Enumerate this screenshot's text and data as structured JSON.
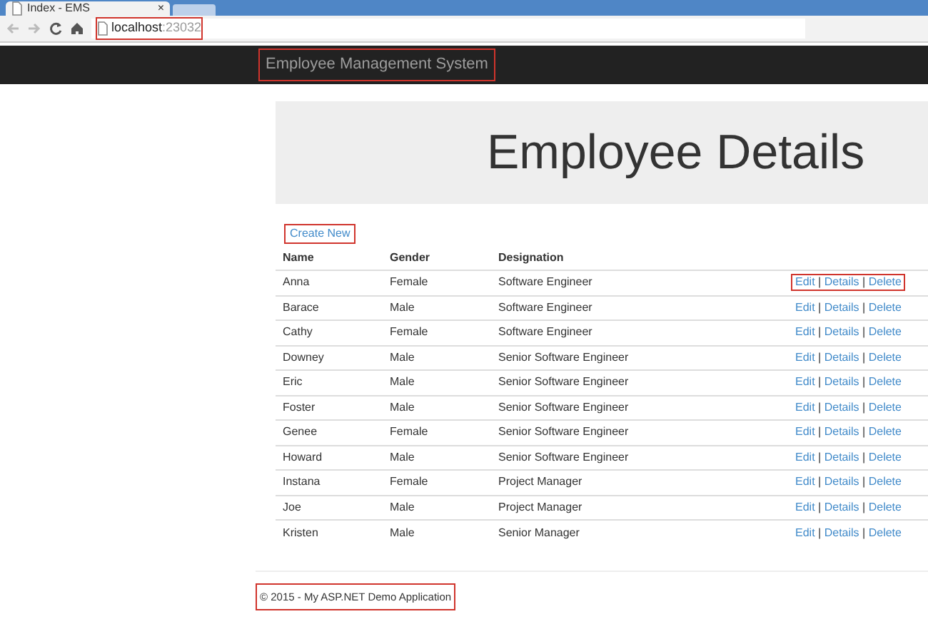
{
  "browser": {
    "tab": {
      "title": "Index - EMS",
      "close": "×"
    },
    "address": {
      "host": "localhost",
      "port": ":23032",
      "highlighted": true
    }
  },
  "navbar": {
    "brand": "Employee Management System",
    "highlighted": true
  },
  "jumbotron": {
    "title": "Employee Details"
  },
  "create_link": {
    "label": "Create New",
    "highlighted": true
  },
  "table": {
    "columns": [
      "Name",
      "Gender",
      "Designation"
    ],
    "action_separator": "|",
    "rows": [
      {
        "name": "Anna",
        "gender": "Female",
        "designation": "Software Engineer",
        "actions": [
          "Edit",
          "Details",
          "Delete"
        ],
        "highlighted": true
      },
      {
        "name": "Barace",
        "gender": "Male",
        "designation": "Software Engineer",
        "actions": [
          "Edit",
          "Details",
          "Delete"
        ],
        "highlighted": false
      },
      {
        "name": "Cathy",
        "gender": "Female",
        "designation": "Software Engineer",
        "actions": [
          "Edit",
          "Details",
          "Delete"
        ],
        "highlighted": false
      },
      {
        "name": "Downey",
        "gender": "Male",
        "designation": "Senior Software Engineer",
        "actions": [
          "Edit",
          "Details",
          "Delete"
        ],
        "highlighted": false
      },
      {
        "name": "Eric",
        "gender": "Male",
        "designation": "Senior Software Engineer",
        "actions": [
          "Edit",
          "Details",
          "Delete"
        ],
        "highlighted": false
      },
      {
        "name": "Foster",
        "gender": "Male",
        "designation": "Senior Software Engineer",
        "actions": [
          "Edit",
          "Details",
          "Delete"
        ],
        "highlighted": false
      },
      {
        "name": "Genee",
        "gender": "Female",
        "designation": "Senior Software Engineer",
        "actions": [
          "Edit",
          "Details",
          "Delete"
        ],
        "highlighted": false
      },
      {
        "name": "Howard",
        "gender": "Male",
        "designation": "Senior Software Engineer",
        "actions": [
          "Edit",
          "Details",
          "Delete"
        ],
        "highlighted": false
      },
      {
        "name": "Instana",
        "gender": "Female",
        "designation": "Project Manager",
        "actions": [
          "Edit",
          "Details",
          "Delete"
        ],
        "highlighted": false
      },
      {
        "name": "Joe",
        "gender": "Male",
        "designation": "Project Manager",
        "actions": [
          "Edit",
          "Details",
          "Delete"
        ],
        "highlighted": false
      },
      {
        "name": "Kristen",
        "gender": "Male",
        "designation": "Senior Manager",
        "actions": [
          "Edit",
          "Details",
          "Delete"
        ],
        "highlighted": false
      }
    ]
  },
  "footer": {
    "text": "© 2015 - My ASP.NET Demo Application",
    "highlighted": true
  }
}
